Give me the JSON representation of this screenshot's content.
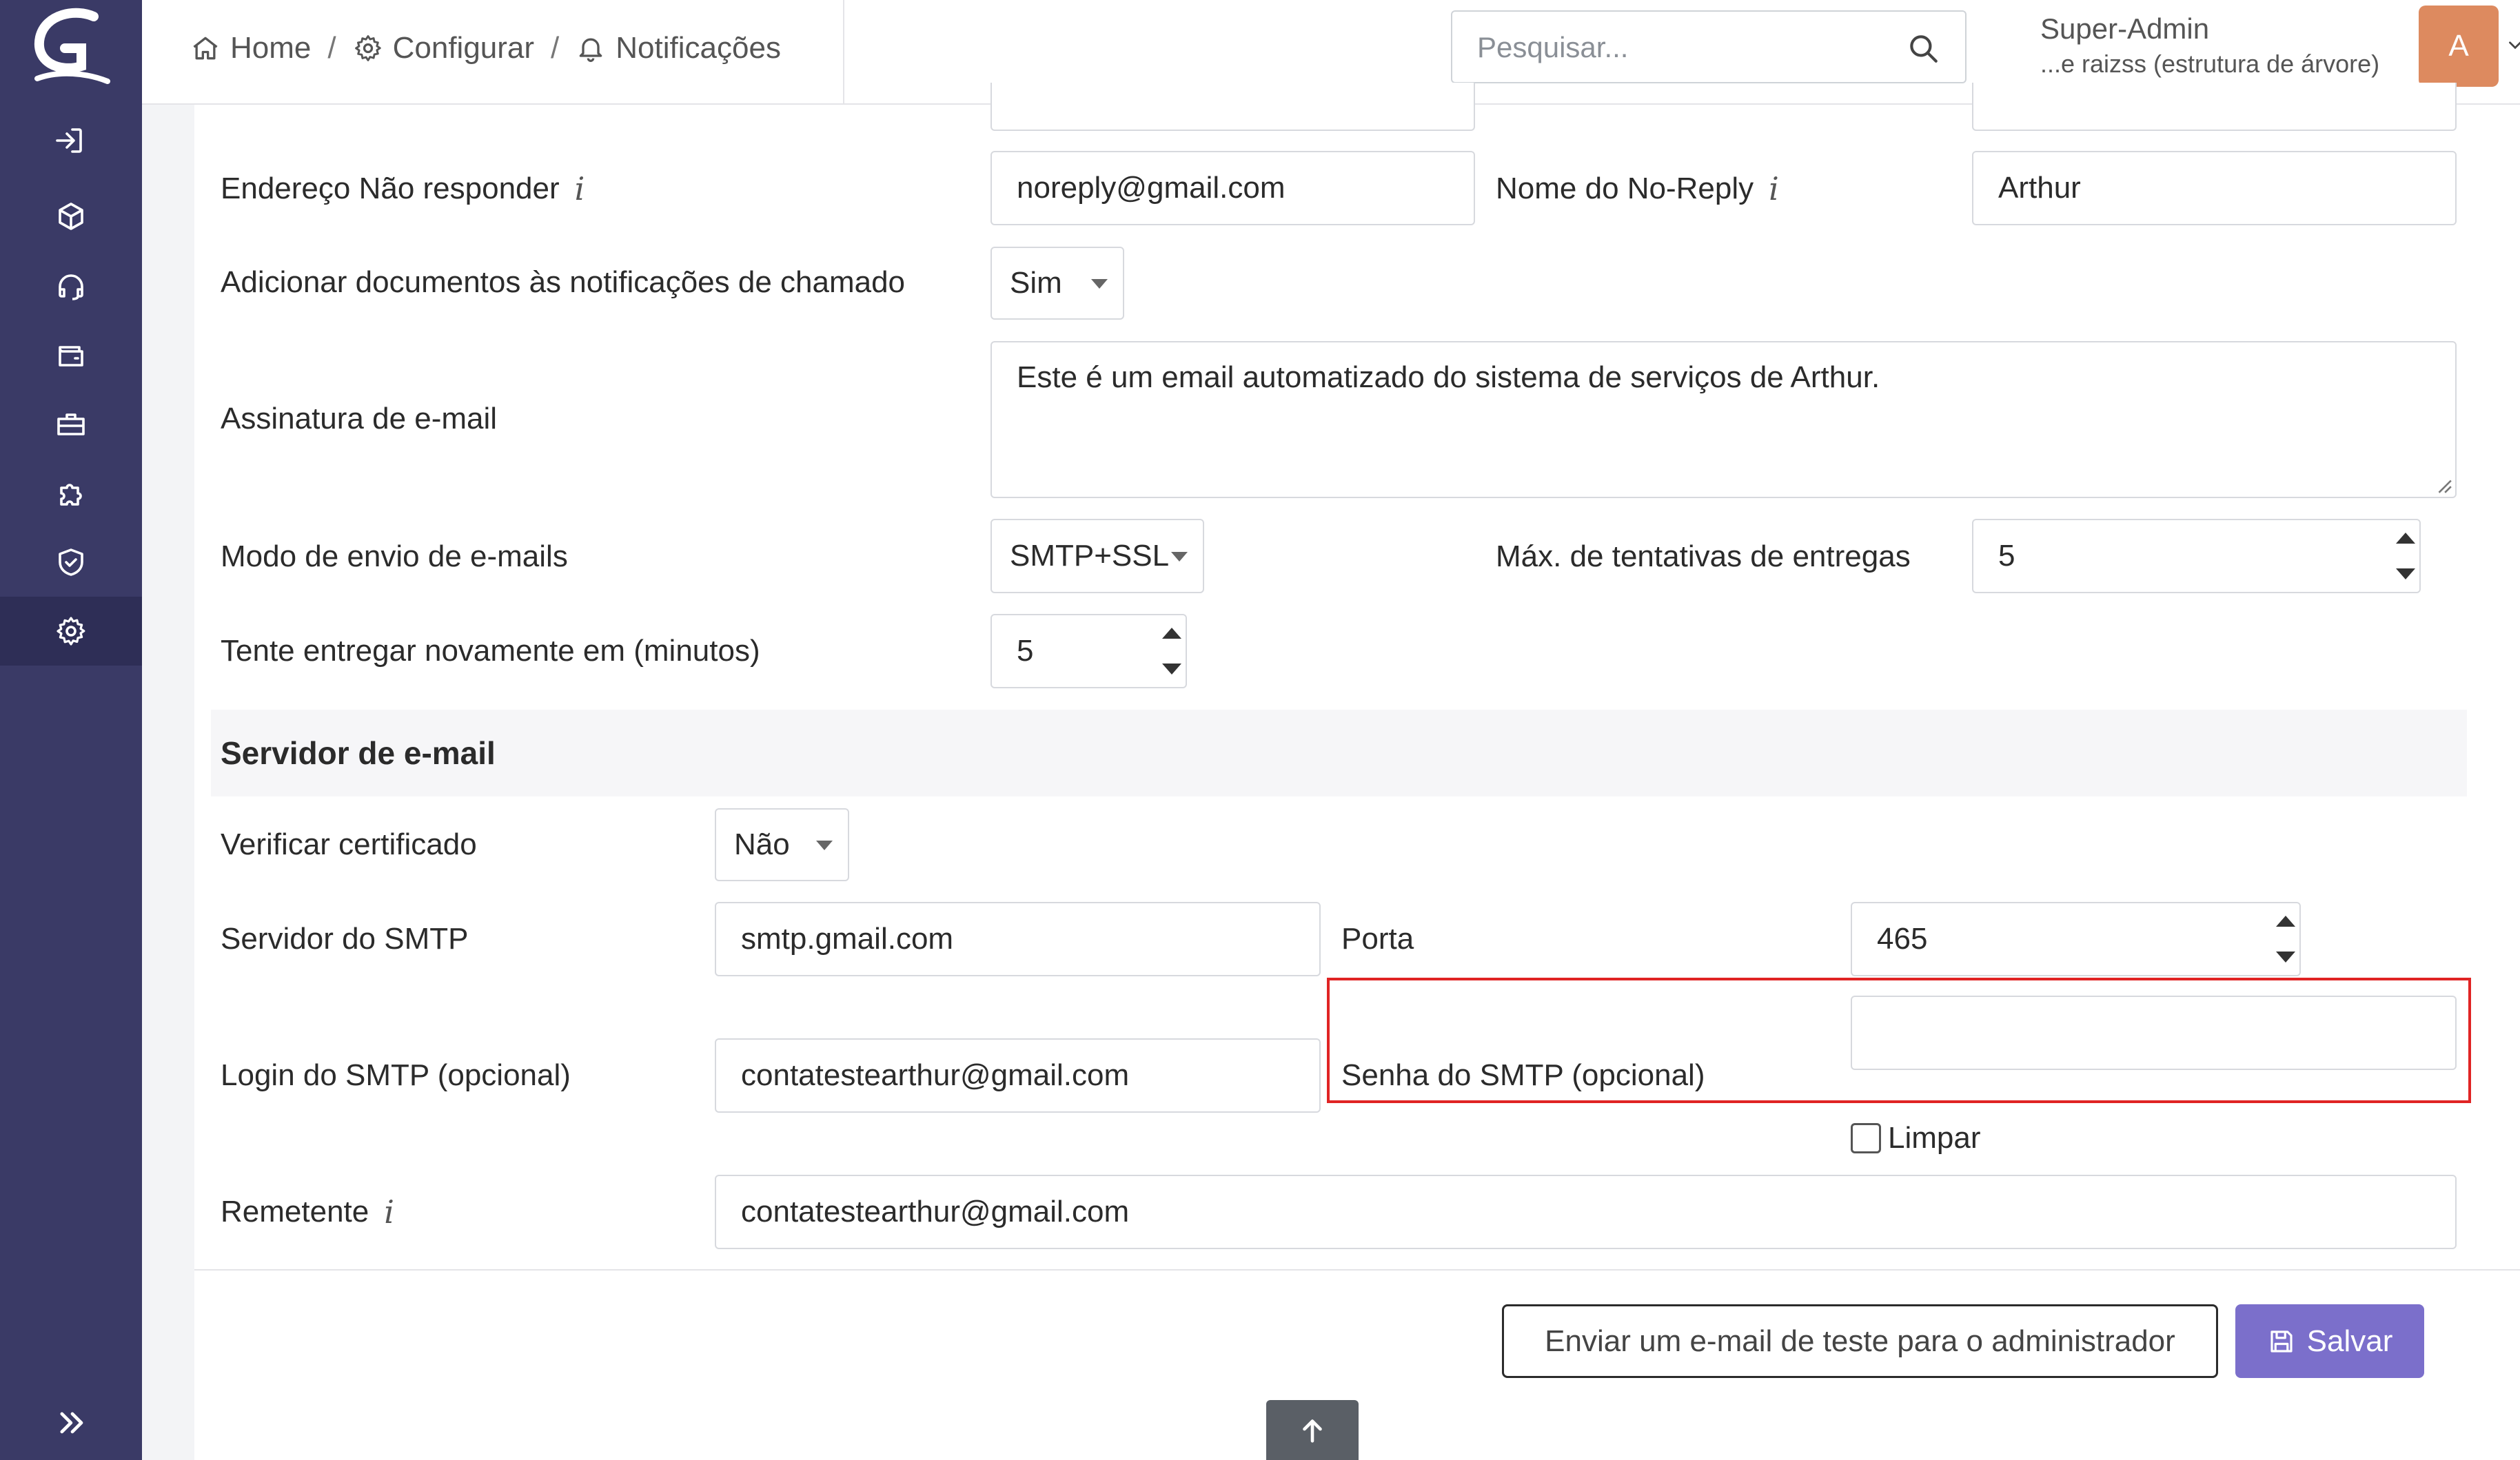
{
  "sidebar": {
    "items": [
      {
        "icon": "sign-in-icon"
      },
      {
        "icon": "box-icon"
      },
      {
        "icon": "headset-icon"
      },
      {
        "icon": "wallet-icon"
      },
      {
        "icon": "briefcase-icon"
      },
      {
        "icon": "puzzle-icon"
      },
      {
        "icon": "shield-check-icon"
      },
      {
        "icon": "gear-icon",
        "active": true
      }
    ],
    "expand_icon": "double-chevron-right-icon"
  },
  "header": {
    "breadcrumb": [
      {
        "label": "Home",
        "icon": "home-icon"
      },
      {
        "label": "Configurar",
        "icon": "gear-icon"
      },
      {
        "label": "Notificações",
        "icon": "bell-icon"
      }
    ],
    "separator": "/",
    "search_placeholder": "Pesquisar...",
    "user_name": "Super-Admin",
    "user_entity": "...e raizss (estrutura de árvore)",
    "avatar_initial": "A"
  },
  "form": {
    "noreply_address_label": "Endereço Não responder",
    "noreply_address_value": "noreply@gmail.com",
    "noreply_name_label": "Nome do No-Reply",
    "noreply_name_value": "Arthur",
    "attach_docs_label": "Adicionar documentos às notificações de chamado",
    "attach_docs_value": "Sim",
    "signature_label": "Assinatura de e-mail",
    "signature_value": "Este é um email automatizado do sistema de serviços de Arthur.",
    "send_mode_label": "Modo de envio de e-mails",
    "send_mode_value": "SMTP+SSL",
    "max_attempts_label": "Máx. de tentativas de entregas",
    "max_attempts_value": "5",
    "retry_label": "Tente entregar novamente em (minutos)",
    "retry_value": "5"
  },
  "mail_server": {
    "section_title": "Servidor de e-mail",
    "verify_cert_label": "Verificar certificado",
    "verify_cert_value": "Não",
    "smtp_server_label": "Servidor do SMTP",
    "smtp_server_value": "smtp.gmail.com",
    "port_label": "Porta",
    "port_value": "465",
    "smtp_login_label": "Login do SMTP (opcional)",
    "smtp_login_value": "contatestearthur@gmail.com",
    "smtp_password_label": "Senha do SMTP (opcional)",
    "smtp_password_value": "",
    "clear_label": "Limpar",
    "sender_label": "Remetente",
    "sender_value": "contatestearthur@gmail.com"
  },
  "actions": {
    "test_email_label": "Enviar um e-mail de teste para o administrador",
    "save_label": "Salvar",
    "save_icon": "floppy-disk-icon",
    "scroll_top_icon": "arrow-up-icon"
  },
  "colors": {
    "sidebar_bg": "#3a3a66",
    "primary": "#7b6fcb",
    "avatar_bg": "#dd8a5f",
    "highlight": "#e02424"
  }
}
